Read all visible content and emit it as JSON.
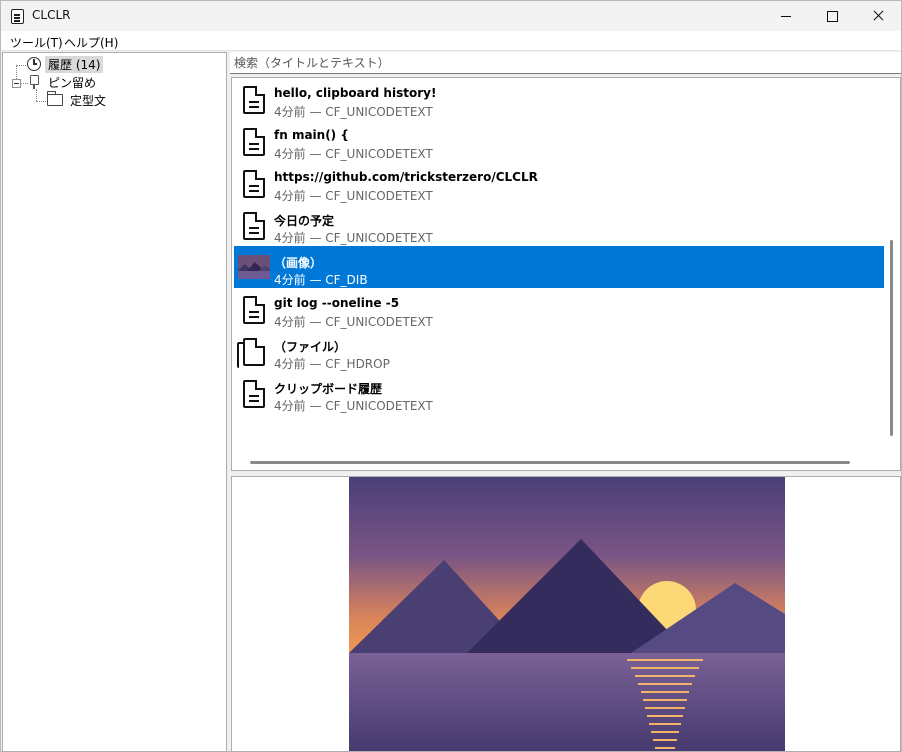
{
  "window": {
    "title": "CLCLR",
    "buttons": {
      "minimize": "minimize",
      "maximize": "maximize",
      "close": "close"
    }
  },
  "menu": {
    "tools": "ツール(T)",
    "help": "ヘルプ(H)"
  },
  "tree": {
    "history_label": "履歴 (14)",
    "pinned_label": "ピン留め",
    "template_label": "定型文"
  },
  "search": {
    "placeholder": "検索（タイトルとテキスト）"
  },
  "items": [
    {
      "title": "hello, clipboard history!",
      "meta": "4分前 — CF_UNICODETEXT",
      "icon": "text-document-icon",
      "selected": false
    },
    {
      "title": "fn main() {",
      "meta": "4分前 — CF_UNICODETEXT",
      "icon": "text-document-icon",
      "selected": false
    },
    {
      "title": "https://github.com/tricksterzero/CLCLR",
      "meta": "4分前 — CF_UNICODETEXT",
      "icon": "text-document-icon",
      "selected": false
    },
    {
      "title": "今日の予定",
      "meta": "4分前 — CF_UNICODETEXT",
      "icon": "text-document-icon",
      "selected": false
    },
    {
      "title": "（画像）",
      "meta": "4分前 — CF_DIB",
      "icon": "image-thumbnail",
      "selected": true
    },
    {
      "title": "git log --oneline -5",
      "meta": "4分前 — CF_UNICODETEXT",
      "icon": "text-document-icon",
      "selected": false
    },
    {
      "title": "（ファイル）",
      "meta": "4分前 — CF_HDROP",
      "icon": "files-icon",
      "selected": false
    },
    {
      "title": "クリップボード履歴",
      "meta": "4分前 — CF_UNICODETEXT",
      "icon": "text-document-icon",
      "selected": false
    }
  ],
  "colors": {
    "selection": "#0078d7",
    "sky_top": "#4a3f78",
    "sky_bottom": "#e88f52",
    "sun": "#fdd876",
    "mountain_left": "#4a3f72",
    "mountain_center": "#342c5c",
    "mountain_right": "#564a82",
    "water": "#6a5890"
  }
}
